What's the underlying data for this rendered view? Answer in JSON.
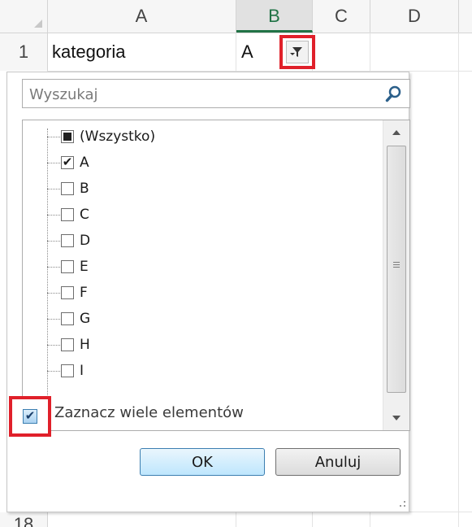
{
  "sheet": {
    "columns": [
      "A",
      "B",
      "C",
      "D"
    ],
    "rows": [
      "1",
      "18"
    ],
    "cell_A1": "kategoria",
    "cell_B1": "A"
  },
  "filter_panel": {
    "search_placeholder": "Wyszukaj",
    "items": [
      {
        "label": "(Wszystko)",
        "state": "partial"
      },
      {
        "label": "A",
        "state": "checked"
      },
      {
        "label": "B",
        "state": "unchecked"
      },
      {
        "label": "C",
        "state": "unchecked"
      },
      {
        "label": "D",
        "state": "unchecked"
      },
      {
        "label": "E",
        "state": "unchecked"
      },
      {
        "label": "F",
        "state": "unchecked"
      },
      {
        "label": "G",
        "state": "unchecked"
      },
      {
        "label": "H",
        "state": "unchecked"
      },
      {
        "label": "I",
        "state": "unchecked"
      }
    ],
    "multi_select_label": "Zaznacz wiele elementów",
    "multi_select_checked": true,
    "ok_label": "OK",
    "cancel_label": "Anuluj"
  },
  "colors": {
    "highlight": "#e0202a",
    "selected_column_accent": "#217346"
  }
}
